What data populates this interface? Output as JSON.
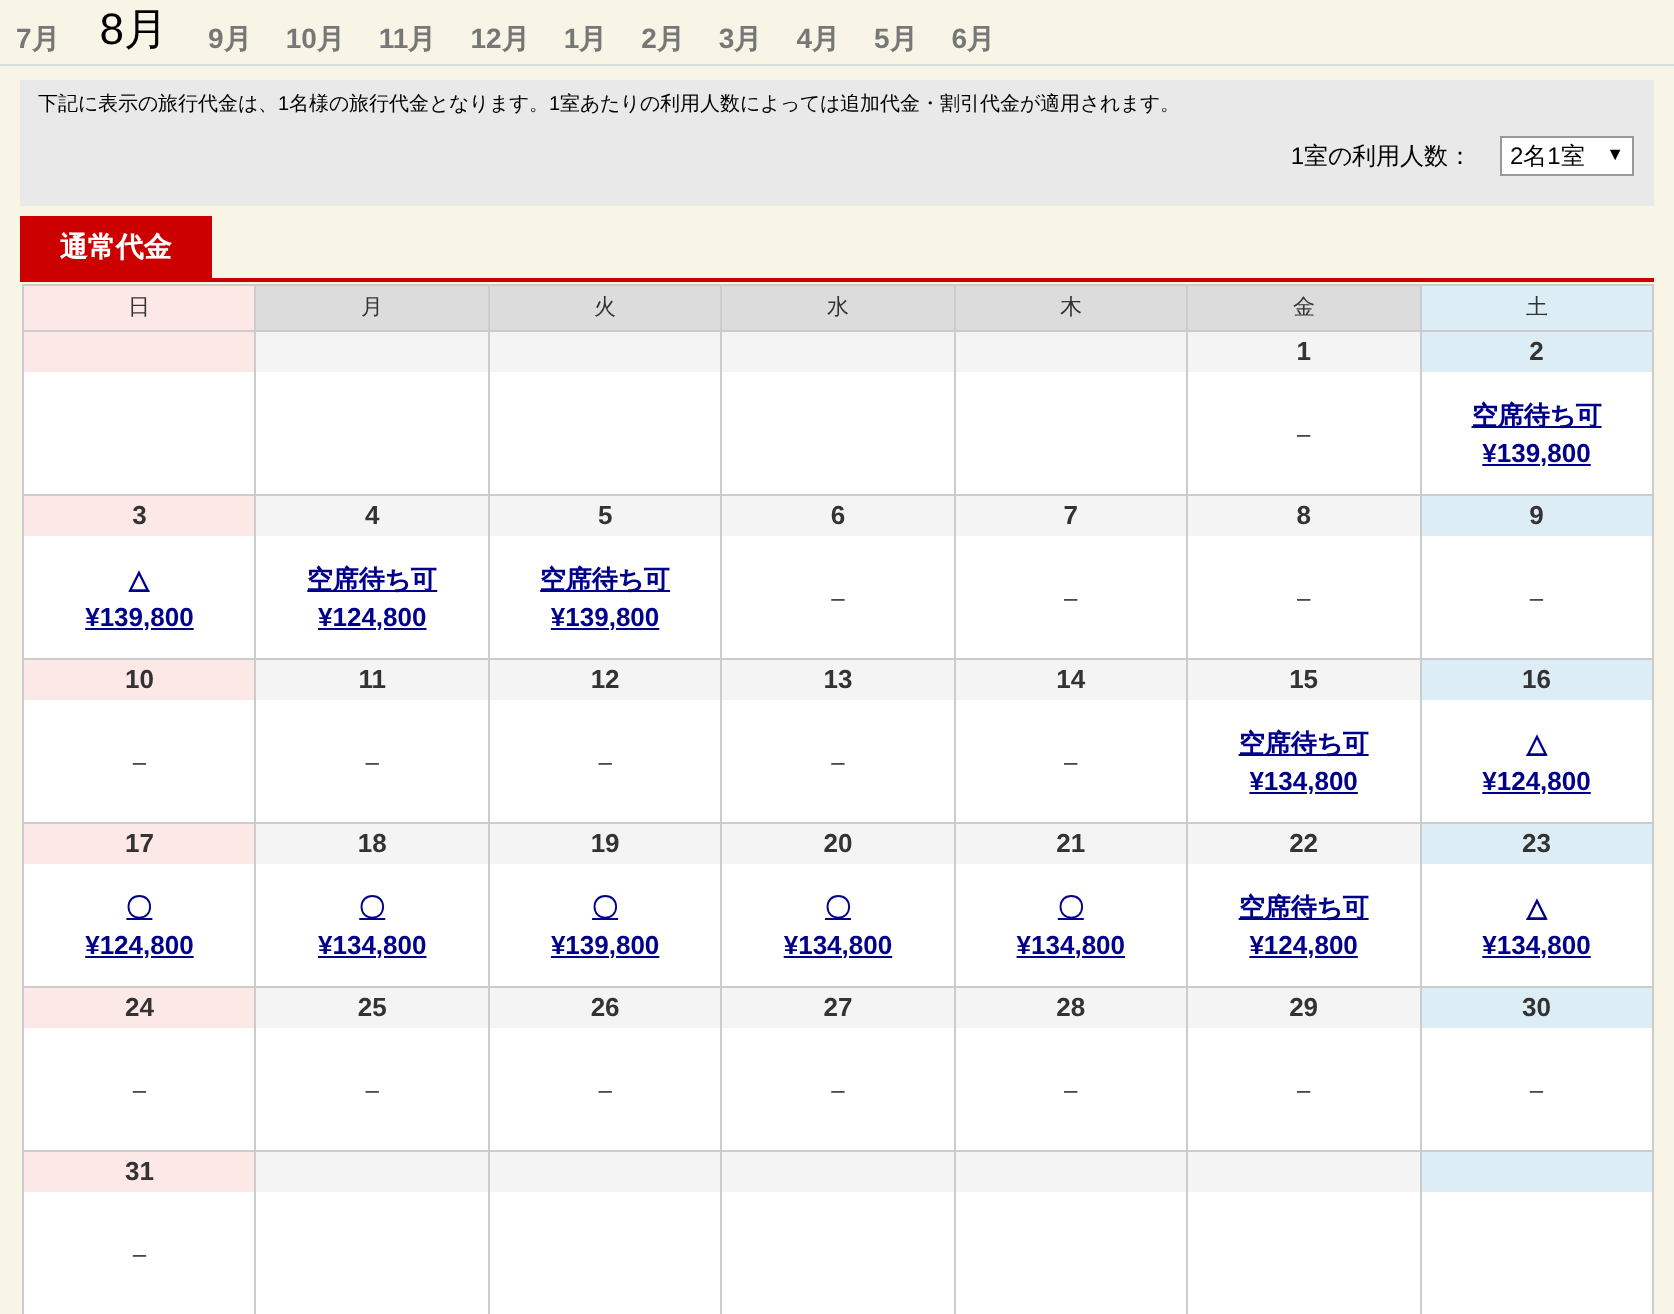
{
  "months": [
    {
      "label": "7月",
      "selected": false
    },
    {
      "label": "8月",
      "selected": true
    },
    {
      "label": "9月",
      "selected": false
    },
    {
      "label": "10月",
      "selected": false
    },
    {
      "label": "11月",
      "selected": false
    },
    {
      "label": "12月",
      "selected": false
    },
    {
      "label": "1月",
      "selected": false
    },
    {
      "label": "2月",
      "selected": false
    },
    {
      "label": "3月",
      "selected": false
    },
    {
      "label": "4月",
      "selected": false
    },
    {
      "label": "5月",
      "selected": false
    },
    {
      "label": "6月",
      "selected": false
    }
  ],
  "notice": "下記に表示の旅行代金は、1名様の旅行代金となります。1室あたりの利用人数によっては追加代金・割引代金が適用されます。",
  "occupancy": {
    "label": "1室の利用人数：",
    "value": "2名1室",
    "caret": "▼"
  },
  "price_tabs": [
    {
      "label": "通常代金",
      "selected": true
    }
  ],
  "calendar": {
    "weekdays": [
      "日",
      "月",
      "火",
      "水",
      "木",
      "金",
      "土"
    ],
    "weeks": [
      [
        {
          "kind": "empty"
        },
        {
          "kind": "empty"
        },
        {
          "kind": "empty"
        },
        {
          "kind": "empty"
        },
        {
          "kind": "empty"
        },
        {
          "kind": "closed",
          "day": "1",
          "status": "–"
        },
        {
          "kind": "open",
          "day": "2",
          "status": "空席待ち可",
          "price": "¥139,800"
        }
      ],
      [
        {
          "kind": "open",
          "day": "3",
          "status": "△",
          "price": "¥139,800"
        },
        {
          "kind": "open",
          "day": "4",
          "status": "空席待ち可",
          "price": "¥124,800"
        },
        {
          "kind": "open",
          "day": "5",
          "status": "空席待ち可",
          "price": "¥139,800"
        },
        {
          "kind": "closed",
          "day": "6",
          "status": "–"
        },
        {
          "kind": "closed",
          "day": "7",
          "status": "–"
        },
        {
          "kind": "closed",
          "day": "8",
          "status": "–"
        },
        {
          "kind": "closed",
          "day": "9",
          "status": "–"
        }
      ],
      [
        {
          "kind": "closed",
          "day": "10",
          "status": "–"
        },
        {
          "kind": "closed",
          "day": "11",
          "status": "–"
        },
        {
          "kind": "closed",
          "day": "12",
          "status": "–"
        },
        {
          "kind": "closed",
          "day": "13",
          "status": "–"
        },
        {
          "kind": "closed",
          "day": "14",
          "status": "–"
        },
        {
          "kind": "open",
          "day": "15",
          "status": "空席待ち可",
          "price": "¥134,800"
        },
        {
          "kind": "open",
          "day": "16",
          "status": "△",
          "price": "¥124,800"
        }
      ],
      [
        {
          "kind": "open",
          "day": "17",
          "status": "〇",
          "price": "¥124,800"
        },
        {
          "kind": "open",
          "day": "18",
          "status": "〇",
          "price": "¥134,800"
        },
        {
          "kind": "open",
          "day": "19",
          "status": "〇",
          "price": "¥139,800"
        },
        {
          "kind": "open",
          "day": "20",
          "status": "〇",
          "price": "¥134,800"
        },
        {
          "kind": "open",
          "day": "21",
          "status": "〇",
          "price": "¥134,800"
        },
        {
          "kind": "open",
          "day": "22",
          "status": "空席待ち可",
          "price": "¥124,800"
        },
        {
          "kind": "open",
          "day": "23",
          "status": "△",
          "price": "¥134,800"
        }
      ],
      [
        {
          "kind": "closed",
          "day": "24",
          "status": "–"
        },
        {
          "kind": "closed",
          "day": "25",
          "status": "–"
        },
        {
          "kind": "closed",
          "day": "26",
          "status": "–"
        },
        {
          "kind": "closed",
          "day": "27",
          "status": "–"
        },
        {
          "kind": "closed",
          "day": "28",
          "status": "–"
        },
        {
          "kind": "closed",
          "day": "29",
          "status": "–"
        },
        {
          "kind": "closed",
          "day": "30",
          "status": "–"
        }
      ],
      [
        {
          "kind": "closed",
          "day": "31",
          "status": "–"
        },
        {
          "kind": "empty"
        },
        {
          "kind": "empty"
        },
        {
          "kind": "empty"
        },
        {
          "kind": "empty"
        },
        {
          "kind": "empty"
        },
        {
          "kind": "empty"
        }
      ]
    ]
  }
}
